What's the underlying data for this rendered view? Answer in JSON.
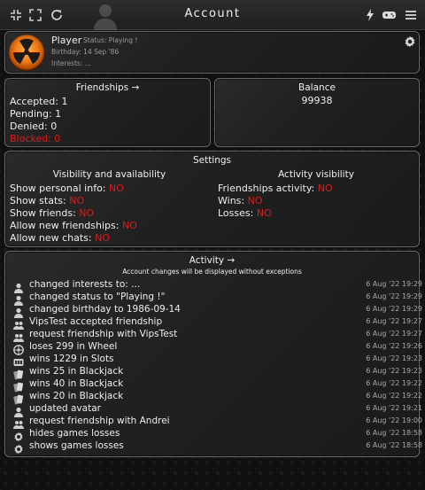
{
  "header": {
    "title": "Account",
    "icons": [
      "collapse-icon",
      "fullscreen-icon",
      "refresh-icon",
      "lightning-icon",
      "gamepad-icon",
      "menu-icon"
    ]
  },
  "profile": {
    "name": "Player",
    "status": "Status: Playing !",
    "birthday": "Birthday: 14 Sep '86",
    "interests": "Interests: ..."
  },
  "friendships": {
    "title": "Friendships →",
    "accepted": "Accepted: 1",
    "pending": "Pending: 1",
    "denied": "Denied: 0",
    "blocked": "Blocked: 0"
  },
  "balance": {
    "title": "Balance",
    "value": "99938"
  },
  "settings": {
    "title": "Settings",
    "col1_title": "Visibility and availability",
    "col2_title": "Activity visibility",
    "col1": [
      {
        "label": "Show personal info:",
        "value": "NO"
      },
      {
        "label": "Show stats:",
        "value": "NO"
      },
      {
        "label": "Show friends:",
        "value": "NO"
      },
      {
        "label": "Allow new friendships:",
        "value": "NO"
      },
      {
        "label": "Allow new chats:",
        "value": "NO"
      }
    ],
    "col2": [
      {
        "label": "Friendships activity:",
        "value": "NO"
      },
      {
        "label": "Wins:",
        "value": "NO"
      },
      {
        "label": "Losses:",
        "value": "NO"
      }
    ]
  },
  "activity": {
    "title": "Activity →",
    "subtitle": "Account changes will be displayed without exceptions",
    "rows": [
      {
        "icon": "user-icon",
        "text": "changed interests to: ...",
        "time": "6 Aug '22 19:29"
      },
      {
        "icon": "user-icon",
        "text": "changed status to \"Playing !\"",
        "time": "6 Aug '22 19:29"
      },
      {
        "icon": "user-icon",
        "text": "changed birthday to 1986-09-14",
        "time": "6 Aug '22 19:29"
      },
      {
        "icon": "users-icon",
        "text": "VipsTest accepted friendship",
        "time": "6 Aug '22 19:27"
      },
      {
        "icon": "users-icon",
        "text": "request friendship with VipsTest",
        "time": "6 Aug '22 19:27"
      },
      {
        "icon": "wheel-icon",
        "text": "loses 299 in Wheel",
        "time": "6 Aug '22 19:26"
      },
      {
        "icon": "slots-icon",
        "text": "wins 1229 in Slots",
        "time": "6 Aug '22 19:23"
      },
      {
        "icon": "cards-icon",
        "text": "wins 25 in Blackjack",
        "time": "6 Aug '22 19:23"
      },
      {
        "icon": "cards-icon",
        "text": "wins 40 in Blackjack",
        "time": "6 Aug '22 19:22"
      },
      {
        "icon": "cards-icon",
        "text": "wins 20 in Blackjack",
        "time": "6 Aug '22 19:22"
      },
      {
        "icon": "user-icon",
        "text": "updated avatar",
        "time": "6 Aug '22 19:21"
      },
      {
        "icon": "users-icon",
        "text": "request friendship with Andrei",
        "time": "6 Aug '22 19:00"
      },
      {
        "icon": "gear-icon",
        "text": "hides games losses",
        "time": "6 Aug '22 18:58"
      },
      {
        "icon": "gear-icon",
        "text": "shows games losses",
        "time": "6 Aug '22 18:58"
      }
    ]
  },
  "colors": {
    "accent_red": "#e01a1a",
    "border": "#6a6a6a",
    "background": "#101010"
  }
}
